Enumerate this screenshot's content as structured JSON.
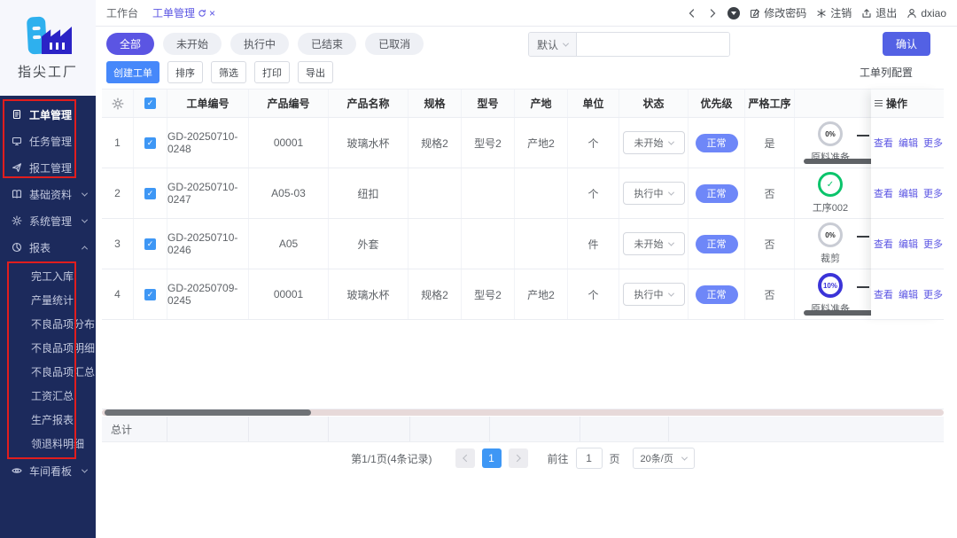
{
  "colors": {
    "accent_indigo": "#5b55e3",
    "primary_blue": "#4688fa",
    "confirm_blue": "#5361e4",
    "badge_blue": "#6e87f8",
    "checkbox_blue": "#3e97f5",
    "sidebar_bg": "#1c2a5c",
    "annotation_red": "#e11d1d",
    "ring_gray": "#c9ccd4",
    "ring_green": "#0bc46b",
    "ring_indigo": "#3b34d8"
  },
  "sidebar": {
    "logo_text": "指尖工厂",
    "menu": [
      {
        "label": "工单管理",
        "icon": "document-icon",
        "active": true
      },
      {
        "label": "任务管理",
        "icon": "monitor-icon"
      },
      {
        "label": "报工管理",
        "icon": "send-icon"
      },
      {
        "label": "基础资料",
        "icon": "book-icon",
        "chevron": "down"
      },
      {
        "label": "系统管理",
        "icon": "gear-icon",
        "chevron": "down"
      },
      {
        "label": "报表",
        "icon": "pie-chart-icon",
        "chevron": "up",
        "expanded": true
      }
    ],
    "report_submenu": [
      "完工入库",
      "产量统计",
      "不良品项分布",
      "不良品项明细",
      "不良品项汇总",
      "工资汇总",
      "生产报表",
      "领退料明细"
    ],
    "workshop_board": "车间看板"
  },
  "topbar": {
    "tab_workbench": "工作台",
    "tab_active": "工单管理",
    "change_password": "修改密码",
    "logout": "注销",
    "exit": "退出",
    "username": "dxiao"
  },
  "filters": {
    "pills": [
      "全部",
      "未开始",
      "执行中",
      "已结束",
      "已取消"
    ],
    "active_pill": "全部",
    "preset": "默认",
    "search_value": "",
    "confirm": "确认",
    "create": "创建工单",
    "sort": "排序",
    "filter": "筛选",
    "print": "打印",
    "export": "导出",
    "column_config": "工单列配置"
  },
  "table": {
    "headers": {
      "order_no": "工单编号",
      "product_no": "产品编号",
      "product_name": "产品名称",
      "spec": "规格",
      "model": "型号",
      "origin": "产地",
      "unit": "单位",
      "status": "状态",
      "priority": "优先级",
      "strict": "严格工序",
      "ops": "操作"
    },
    "rows": [
      {
        "no": "1",
        "order_no": "GD-20250710-0248",
        "product_no": "00001",
        "product_name": "玻璃水杯",
        "spec": "规格2",
        "model": "型号2",
        "origin": "产地2",
        "unit": "个",
        "status": "未开始",
        "priority": "正常",
        "strict": "是",
        "progress_percent": "0%",
        "progress_step": "原料准备"
      },
      {
        "no": "2",
        "order_no": "GD-20250710-0247",
        "product_no": "A05-03",
        "product_name": "纽扣",
        "spec": "",
        "model": "",
        "origin": "",
        "unit": "个",
        "status": "执行中",
        "priority": "正常",
        "strict": "否",
        "progress_percent": "",
        "progress_step": "工序002"
      },
      {
        "no": "3",
        "order_no": "GD-20250710-0246",
        "product_no": "A05",
        "product_name": "外套",
        "spec": "",
        "model": "",
        "origin": "",
        "unit": "件",
        "status": "未开始",
        "priority": "正常",
        "strict": "否",
        "progress_percent": "0%",
        "progress_step": "裁剪"
      },
      {
        "no": "4",
        "order_no": "GD-20250709-0245",
        "product_no": "00001",
        "product_name": "玻璃水杯",
        "spec": "规格2",
        "model": "型号2",
        "origin": "产地2",
        "unit": "个",
        "status": "执行中",
        "priority": "正常",
        "strict": "否",
        "progress_percent": "10%",
        "progress_step": "原料准备"
      }
    ],
    "actions": {
      "view": "查看",
      "edit": "编辑",
      "more": "更多"
    },
    "total_label": "总计"
  },
  "pagination": {
    "summary": "第1/1页(4条记录)",
    "page": "1",
    "goto_label": "前往",
    "goto_value": "1",
    "page_unit": "页",
    "page_size": "20条/页"
  }
}
